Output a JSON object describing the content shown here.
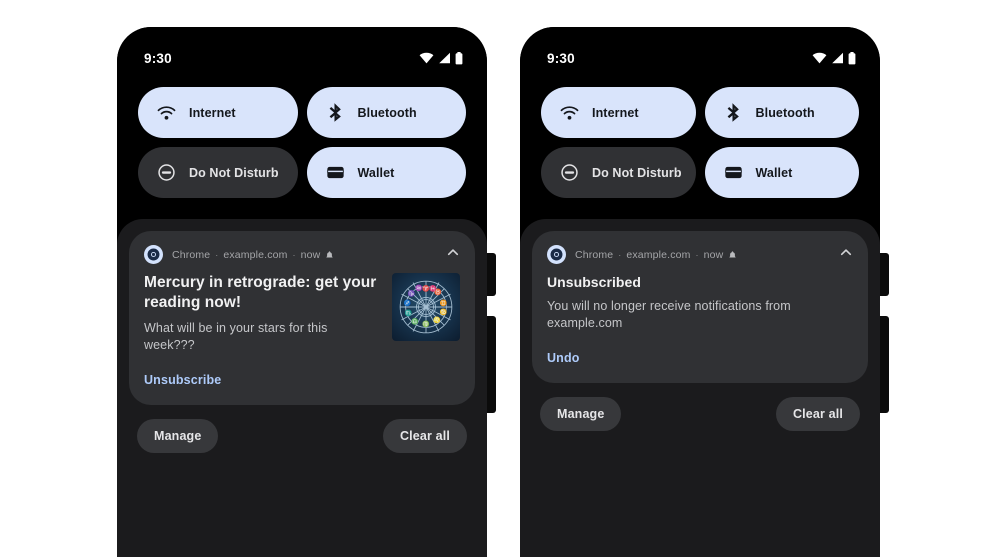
{
  "meta": {
    "background_color": "#ffffff",
    "accent_link_color": "#aecbfa",
    "tile_on_color": "#d9e4fb",
    "tile_off_color": "#303134",
    "shade_color": "#1b1b1d",
    "notification_color": "#303134"
  },
  "phones": [
    {
      "id": "before",
      "status_bar": {
        "clock": "9:30",
        "icons": [
          "wifi-icon",
          "cellular-signal-icon",
          "battery-icon"
        ]
      },
      "quick_settings": {
        "tiles": [
          {
            "label": "Internet",
            "icon": "wifi-icon",
            "state": "on"
          },
          {
            "label": "Bluetooth",
            "icon": "bluetooth-icon",
            "state": "on"
          },
          {
            "label": "Do Not Disturb",
            "icon": "do-not-disturb-icon",
            "state": "off"
          },
          {
            "label": "Wallet",
            "icon": "wallet-icon",
            "state": "on"
          }
        ]
      },
      "notification": {
        "app_icon": "chrome-icon",
        "app_name": "Chrome",
        "source": "example.com",
        "time": "now",
        "alert_icon": "bell-icon",
        "collapse_icon": "chevron-up-icon",
        "title": "Mercury in retrograde: get your reading now!",
        "body": "What will be in your stars for this week???",
        "action": "Unsubscribe",
        "image": "zodiac-wheel-image"
      },
      "footer": {
        "manage": "Manage",
        "clear_all": "Clear all"
      }
    },
    {
      "id": "after",
      "status_bar": {
        "clock": "9:30",
        "icons": [
          "wifi-icon",
          "cellular-signal-icon",
          "battery-icon"
        ]
      },
      "quick_settings": {
        "tiles": [
          {
            "label": "Internet",
            "icon": "wifi-icon",
            "state": "on"
          },
          {
            "label": "Bluetooth",
            "icon": "bluetooth-icon",
            "state": "on"
          },
          {
            "label": "Do Not Disturb",
            "icon": "do-not-disturb-icon",
            "state": "off"
          },
          {
            "label": "Wallet",
            "icon": "wallet-icon",
            "state": "on"
          }
        ]
      },
      "notification": {
        "app_icon": "chrome-icon",
        "app_name": "Chrome",
        "source": "example.com",
        "time": "now",
        "alert_icon": "bell-icon",
        "collapse_icon": "chevron-up-icon",
        "title": "Unsubscribed",
        "body": "You will no longer receive notifications from example.com",
        "action": "Undo",
        "image": null
      },
      "footer": {
        "manage": "Manage",
        "clear_all": "Clear all"
      }
    }
  ],
  "separators": {
    "dot": "·"
  }
}
